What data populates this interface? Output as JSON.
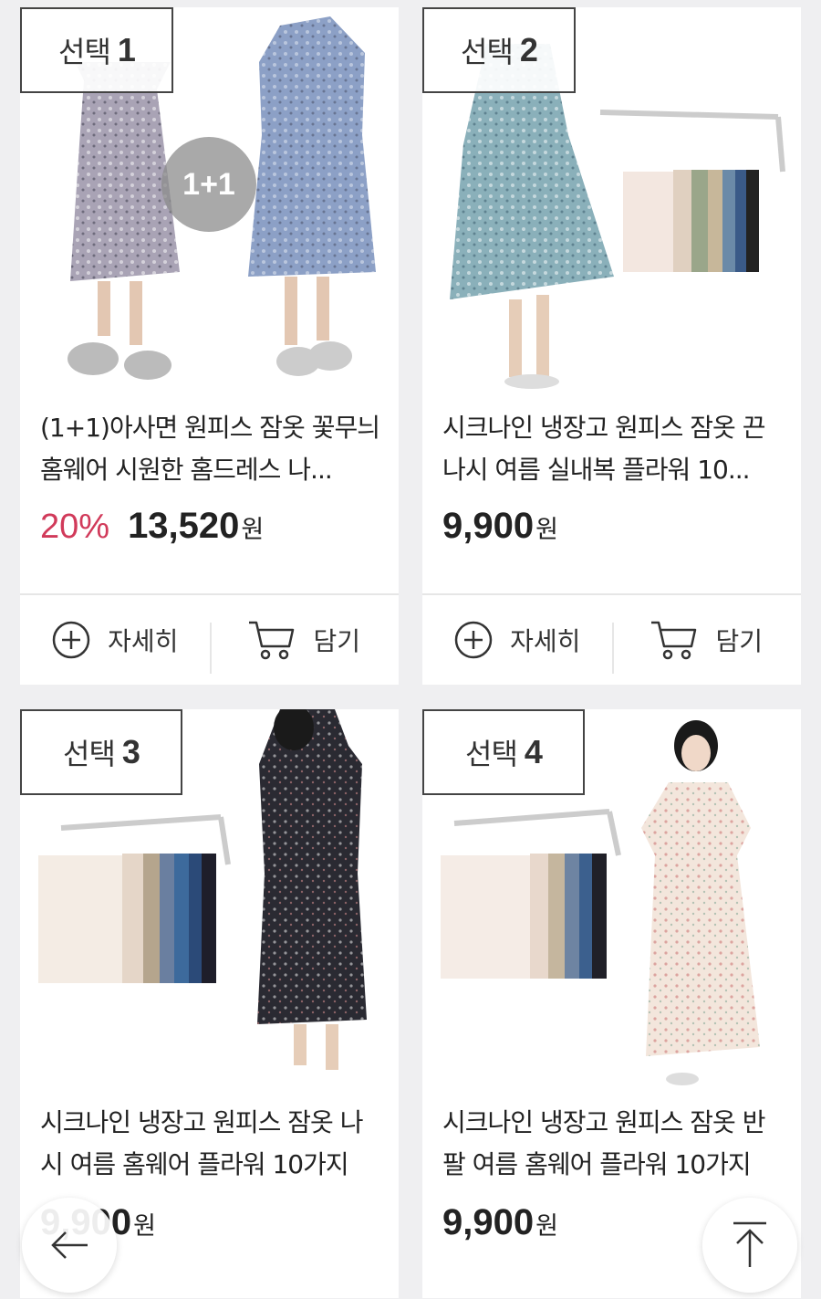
{
  "products": [
    {
      "label_prefix": "선택",
      "label_number": "1",
      "badge": "1+1",
      "title": "(1+1)아사면 원피스 잠옷 꽃무늬 홈웨어 시원한 홈드레스 나...",
      "discount": "20%",
      "price": "13,520",
      "currency": "원",
      "detail_label": "자세히",
      "cart_label": "담기"
    },
    {
      "label_prefix": "선택",
      "label_number": "2",
      "title": "시크나인 냉장고 원피스 잠옷 끈나시 여름 실내복 플라워 10...",
      "price": "9,900",
      "currency": "원",
      "detail_label": "자세히",
      "cart_label": "담기"
    },
    {
      "label_prefix": "선택",
      "label_number": "3",
      "title": "시크나인 냉장고 원피스 잠옷 나시 여름 홈웨어 플라워 10가지",
      "price": "9,900",
      "currency": "원"
    },
    {
      "label_prefix": "선택",
      "label_number": "4",
      "title": "시크나인 냉장고 원피스 잠옷 반팔 여름 홈웨어 플라워 10가지",
      "price": "9,900",
      "currency": "원"
    }
  ],
  "icons": {
    "detail": "plus-circle-icon",
    "cart": "cart-icon",
    "back": "arrow-left-icon",
    "top": "arrow-up-icon"
  },
  "colors": {
    "discount": "#d13a5a",
    "background": "#efeff1"
  }
}
